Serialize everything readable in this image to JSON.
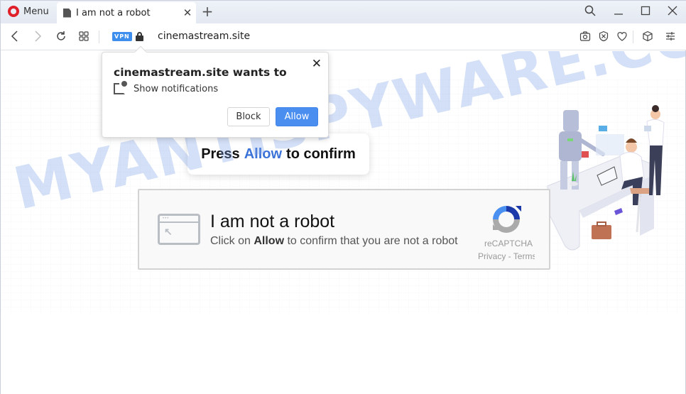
{
  "browser": {
    "menu_label": "Menu",
    "tab": {
      "title": "I am not a robot",
      "close_glyph": "✕"
    },
    "new_tab_glyph": "+",
    "window_controls": {
      "search": "⚲",
      "minimize": "_",
      "maximize": "☐",
      "close": "✕"
    },
    "nav": {
      "back": "‹",
      "forward": "›",
      "reload": "↻",
      "tabs_grid": "⊞"
    },
    "vpn_label": "VPN",
    "url": "cinemastream.site",
    "toolbar_icons": [
      "camera-icon",
      "ad-block-icon",
      "heart-icon",
      "cube-icon",
      "settings-sliders-icon"
    ],
    "accent_color": "#3d8eed"
  },
  "notification_prompt": {
    "title": "cinemastream.site wants to",
    "permission": "Show notifications",
    "close_glyph": "✕",
    "block_label": "Block",
    "allow_label": "Allow"
  },
  "press_box": {
    "before": "Press",
    "highlight": "Allow",
    "after": "to confirm",
    "highlight_color": "#3b73d8"
  },
  "captcha": {
    "title": "I am not a robot",
    "sub_before": "Click on",
    "sub_bold": "Allow",
    "sub_after": "to confirm that you are not a robot",
    "brand": "reCAPTCHA",
    "links": "Privacy - Terms"
  },
  "watermark": "MYANTISPYWARE.COM"
}
